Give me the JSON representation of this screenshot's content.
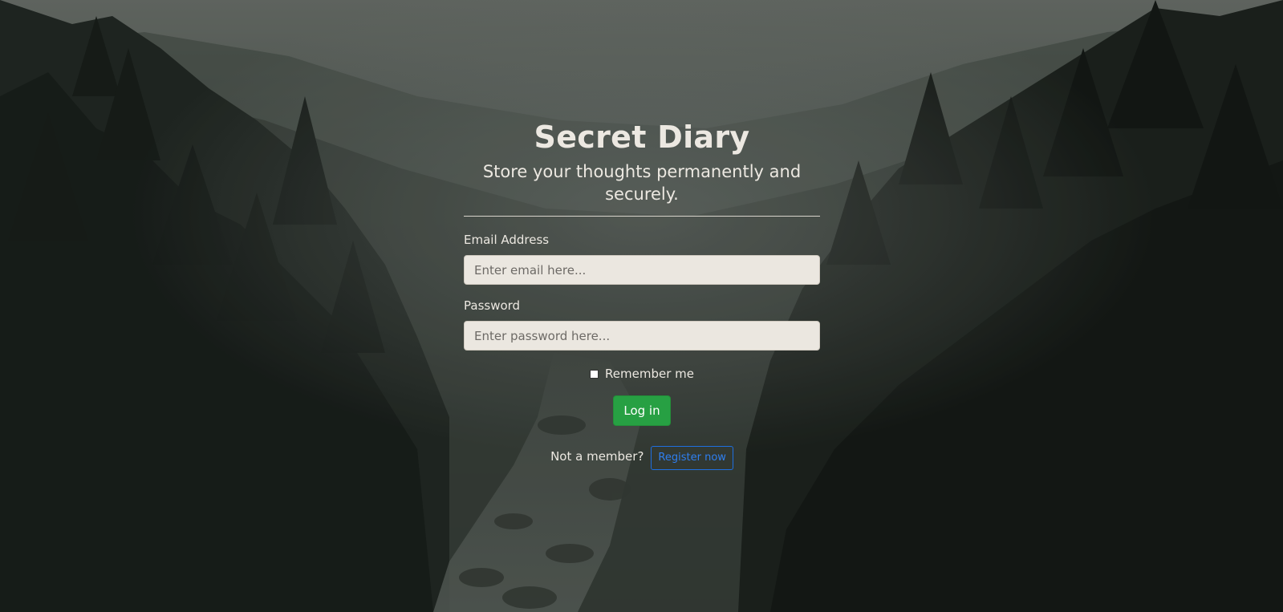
{
  "header": {
    "title": "Secret Diary",
    "subtitle": "Store your thoughts permanently and securely."
  },
  "form": {
    "email_label": "Email Address",
    "email_placeholder": "Enter email here...",
    "email_value": "",
    "password_label": "Password",
    "password_placeholder": "Enter password here...",
    "password_value": "",
    "remember_label": "Remember me",
    "remember_checked": false,
    "login_label": "Log in"
  },
  "footer": {
    "prompt": "Not a member?",
    "register_label": "Register now"
  },
  "colors": {
    "login_button": "#27a043",
    "register_border": "#1f6fe0",
    "input_background": "#ebe7e0",
    "text": "#ece8e1"
  },
  "background": {
    "description_icon": "forest-river-background"
  }
}
